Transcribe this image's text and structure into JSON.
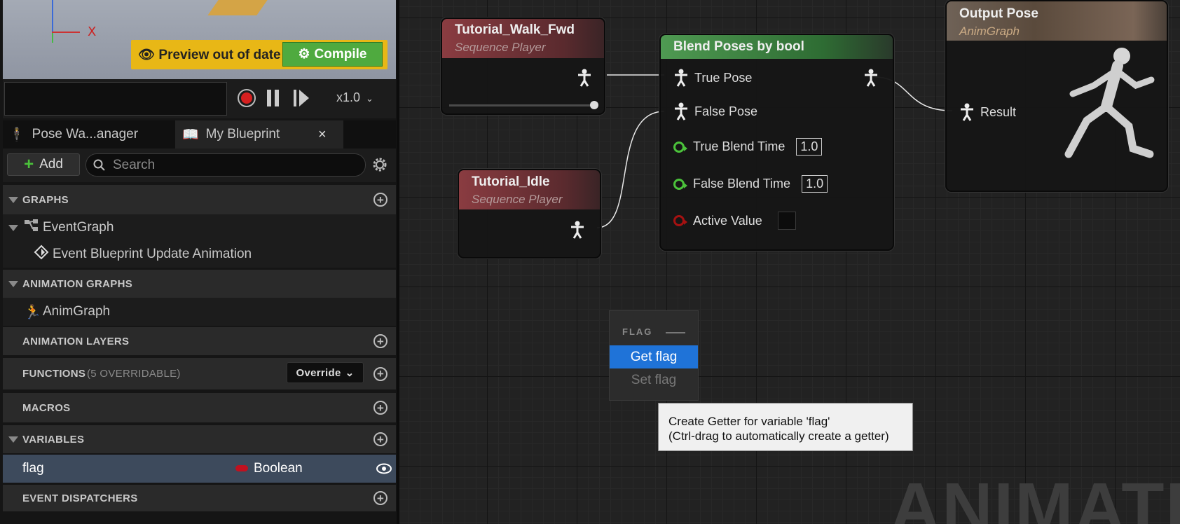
{
  "viewport": {
    "axis_x_label": "X",
    "preview_status": "Preview out of date",
    "compile_label": "Compile"
  },
  "transport": {
    "speed": "x1.0"
  },
  "tabs": [
    {
      "label": "Pose Wa...anager"
    },
    {
      "label": "My Blueprint",
      "close": "×"
    }
  ],
  "toolbar": {
    "add_label": "Add",
    "search_placeholder": "Search"
  },
  "sections": {
    "graphs": "GRAPHS",
    "event_graph": "EventGraph",
    "event_update": "Event Blueprint Update Animation",
    "animation_graphs": "ANIMATION GRAPHS",
    "anim_graph": "AnimGraph",
    "animation_layers": "ANIMATION LAYERS",
    "functions": "FUNCTIONS",
    "functions_note": "(5 OVERRIDABLE)",
    "override_label": "Override",
    "macros": "MACROS",
    "variables": "VARIABLES",
    "event_dispatchers": "EVENT DISPATCHERS"
  },
  "variable": {
    "name": "flag",
    "type": "Boolean",
    "type_color": "#c0111f"
  },
  "nodes": {
    "walk": {
      "title": "Tutorial_Walk_Fwd",
      "subtitle": "Sequence Player"
    },
    "idle": {
      "title": "Tutorial_Idle",
      "subtitle": "Sequence Player"
    },
    "blend": {
      "title": "Blend Poses by bool",
      "true_pose": "True Pose",
      "false_pose": "False Pose",
      "true_blend_time": "True Blend Time",
      "true_blend_value": "1.0",
      "false_blend_time": "False Blend Time",
      "false_blend_value": "1.0",
      "active_value": "Active Value"
    },
    "output": {
      "title": "Output Pose",
      "subtitle": "AnimGraph",
      "result": "Result"
    }
  },
  "context_menu": {
    "header": "FLAG",
    "get": "Get flag",
    "set": "Set flag"
  },
  "tooltip": {
    "line1": "Create Getter for variable 'flag'",
    "line2": "(Ctrl-drag to automatically create a getter)"
  },
  "watermark": "ANIMATION",
  "colors": {
    "sequence_header": "#7a3a3e",
    "blend_header": "#3e7a42",
    "output_header": "#6e5b4a",
    "float_pin": "#4bc23b",
    "bool_pin": "#a51111",
    "selection": "#1f73d8"
  }
}
